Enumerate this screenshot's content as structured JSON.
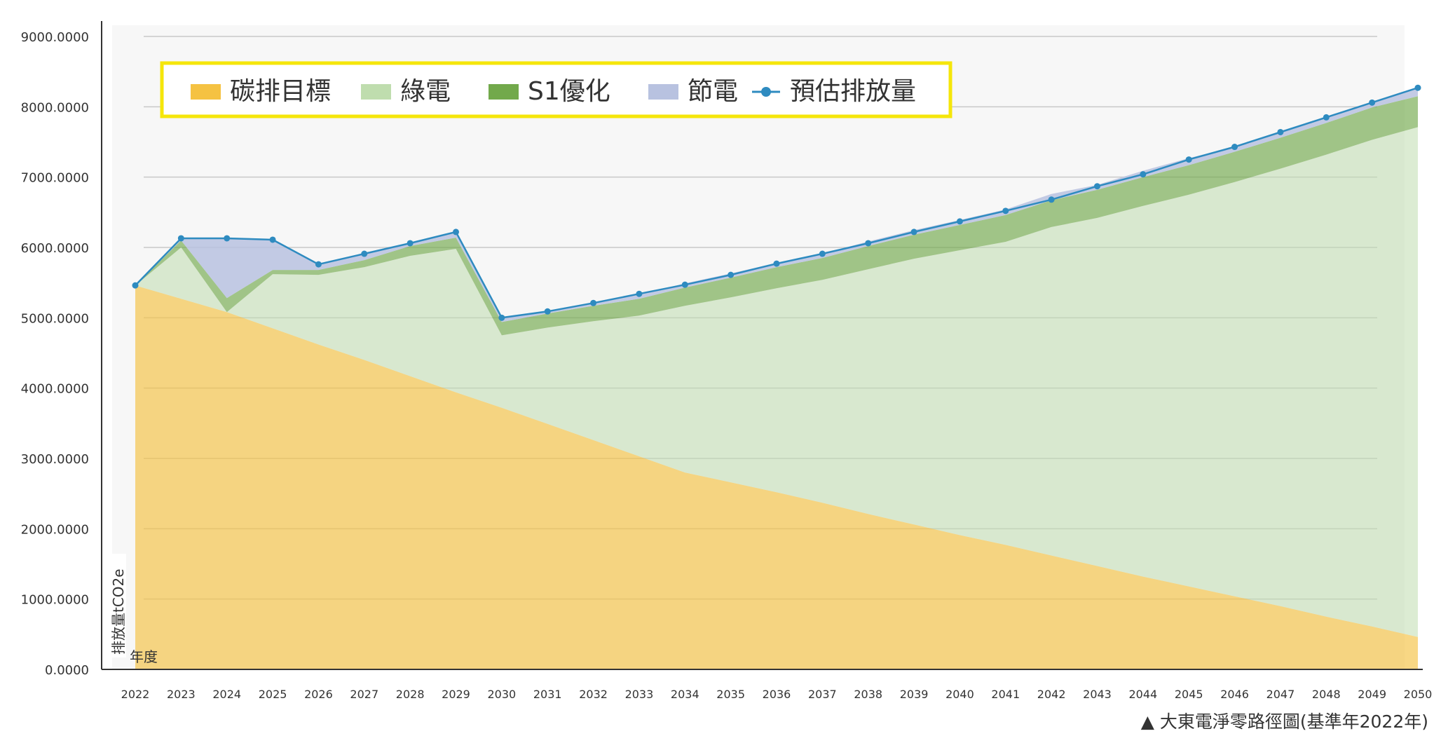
{
  "chart_data": {
    "type": "area",
    "title": "",
    "caption": "▲ 大東電淨零路徑圖(基準年2022年)",
    "ylabel": "排放量tCO2e",
    "xlabel": "年度",
    "ylim": [
      0,
      9000
    ],
    "grid": true,
    "legend_position": "top-left",
    "y_ticks": [
      "0.0000",
      "1000.0000",
      "2000.0000",
      "3000.0000",
      "4000.0000",
      "5000.0000",
      "6000.0000",
      "7000.0000",
      "8000.0000",
      "9000.0000"
    ],
    "categories": [
      "2022",
      "2023",
      "2024",
      "2025",
      "2026",
      "2027",
      "2028",
      "2029",
      "2030",
      "2031",
      "2032",
      "2033",
      "2034",
      "2035",
      "2036",
      "2037",
      "2038",
      "2039",
      "2040",
      "2041",
      "2042",
      "2043",
      "2044",
      "2045",
      "2046",
      "2047",
      "2048",
      "2049",
      "2050"
    ],
    "series": [
      {
        "name": "碳排目標",
        "color": "#F5C242",
        "values": [
          5460,
          5270,
          5080,
          4850,
          4620,
          4400,
          4170,
          3940,
          3720,
          3490,
          3260,
          3030,
          2800,
          2660,
          2520,
          2370,
          2210,
          2060,
          1910,
          1770,
          1620,
          1470,
          1320,
          1180,
          1040,
          900,
          750,
          610,
          460
        ]
      },
      {
        "name": "綠電",
        "color": "#BFDDAE",
        "values": [
          0,
          730,
          0,
          770,
          990,
          1320,
          1710,
          2040,
          1030,
          1370,
          1690,
          2000,
          2370,
          2630,
          2900,
          3170,
          3480,
          3780,
          4050,
          4310,
          4670,
          4950,
          5270,
          5570,
          5890,
          6220,
          6570,
          6920,
          7250
        ]
      },
      {
        "name": "S1優化",
        "color": "#72A94B",
        "values": [
          0,
          100,
          200,
          60,
          70,
          100,
          140,
          160,
          190,
          200,
          220,
          240,
          260,
          280,
          300,
          310,
          330,
          340,
          360,
          380,
          380,
          400,
          410,
          420,
          430,
          440,
          450,
          460,
          440
        ]
      },
      {
        "name": "節電",
        "color": "#B8C2E0",
        "values": [
          0,
          40,
          860,
          440,
          90,
          100,
          50,
          90,
          60,
          40,
          45,
          60,
          60,
          60,
          60,
          60,
          65,
          65,
          70,
          80,
          90,
          70,
          90,
          100,
          70,
          90,
          90,
          70,
          130
        ]
      }
    ],
    "line_series": {
      "name": "預估排放量",
      "color": "#2E8BC0",
      "values": [
        5460,
        6130,
        6130,
        6110,
        5760,
        5910,
        6060,
        6220,
        5000,
        5090,
        5210,
        5340,
        5470,
        5610,
        5770,
        5910,
        6060,
        6220,
        6370,
        6520,
        6680,
        6870,
        7040,
        7250,
        7430,
        7640,
        7850,
        8060,
        8270
      ]
    }
  }
}
